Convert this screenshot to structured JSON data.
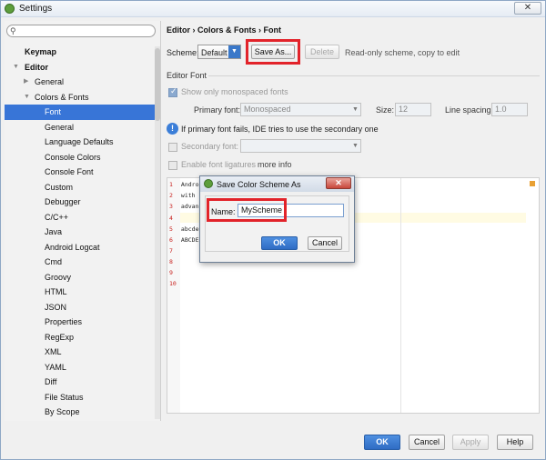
{
  "window": {
    "title": "Settings",
    "close_label": "✕"
  },
  "sidebar": {
    "search_placeholder": "",
    "items": [
      {
        "label": "Keymap"
      },
      {
        "label": "Editor"
      },
      {
        "label": "General"
      },
      {
        "label": "Colors & Fonts"
      },
      {
        "label": "Font"
      },
      {
        "label": "General"
      },
      {
        "label": "Language Defaults"
      },
      {
        "label": "Console Colors"
      },
      {
        "label": "Console Font"
      },
      {
        "label": "Custom"
      },
      {
        "label": "Debugger"
      },
      {
        "label": "C/C++"
      },
      {
        "label": "Java"
      },
      {
        "label": "Android Logcat"
      },
      {
        "label": "Cmd"
      },
      {
        "label": "Groovy"
      },
      {
        "label": "HTML"
      },
      {
        "label": "JSON"
      },
      {
        "label": "Properties"
      },
      {
        "label": "RegExp"
      },
      {
        "label": "XML"
      },
      {
        "label": "YAML"
      },
      {
        "label": "Diff"
      },
      {
        "label": "File Status"
      },
      {
        "label": "By Scope"
      }
    ]
  },
  "panel": {
    "breadcrumb": "Editor › Colors & Fonts › Font",
    "scheme_label": "Scheme:",
    "scheme_value": "Default",
    "save_as_label": "Save As...",
    "delete_label": "Delete",
    "readonly_note": "Read-only scheme, copy to edit",
    "section_title": "Editor Font",
    "show_mono_label": "Show only monospaced fonts",
    "primary_font_label": "Primary font:",
    "primary_font_value": "Monospaced",
    "size_label": "Size:",
    "size_value": "12",
    "line_spacing_label": "Line spacing:",
    "line_spacing_value": "1.0",
    "info_text": "If primary font fails, IDE tries to use the secondary one",
    "secondary_font_label": "Secondary font:",
    "ligatures_label": "Enable font ligatures",
    "more_info": "more info"
  },
  "editor": {
    "lines": [
      {
        "num": "1",
        "text": "Android"
      },
      {
        "num": "2",
        "text": "with"
      },
      {
        "num": "3",
        "text": "advanc"
      },
      {
        "num": "4",
        "text": ""
      },
      {
        "num": "5",
        "text": "abcdef"
      },
      {
        "num": "6",
        "text": "ABCDEF"
      },
      {
        "num": "7",
        "text": ""
      },
      {
        "num": "8",
        "text": ""
      },
      {
        "num": "9",
        "text": ""
      },
      {
        "num": "10",
        "text": ""
      }
    ]
  },
  "footer": {
    "ok": "OK",
    "cancel": "Cancel",
    "apply": "Apply",
    "help": "Help"
  },
  "dialog": {
    "title": "Save Color Scheme As",
    "name_label": "Name:",
    "name_value": "MyScheme",
    "ok": "OK",
    "cancel": "Cancel"
  }
}
